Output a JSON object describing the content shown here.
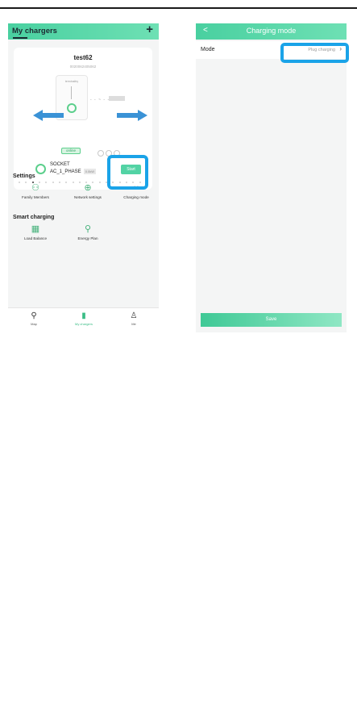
{
  "left_screen": {
    "title": "My chargers",
    "add_icon": "+",
    "card": {
      "name": "test62",
      "serial": "0020062405062",
      "device_label": "terminaltry",
      "status": "online",
      "connector": "SOCKET",
      "phase": "AC_1_PHASE",
      "power": "0.0kW",
      "start_label": "Start"
    },
    "settings": {
      "heading": "Settings",
      "items": [
        {
          "label": "Family Members",
          "icon": "family-icon"
        },
        {
          "label": "Network settings",
          "icon": "globe-icon"
        },
        {
          "label": "Charging mode",
          "icon": "charging-mode-icon"
        }
      ]
    },
    "smart_charging": {
      "heading": "Smart charging",
      "items": [
        {
          "label": "Load Balance",
          "icon": "load-balance-icon"
        },
        {
          "label": "Energy Plan",
          "icon": "energy-plan-icon"
        }
      ]
    },
    "tabs": [
      {
        "label": "Map",
        "active": false
      },
      {
        "label": "My chargers",
        "active": true
      },
      {
        "label": "Me",
        "active": false
      }
    ]
  },
  "right_screen": {
    "title": "Charging mode",
    "back_icon": "back-chevron-icon",
    "mode_label": "Mode",
    "mode_value": "Plug charging",
    "save_label": "Save"
  },
  "colors": {
    "header_green": "#49d0a0",
    "accent_green": "#3bbd86",
    "highlight_blue": "#1aa3e8",
    "arrow_blue": "#3a92d6"
  }
}
